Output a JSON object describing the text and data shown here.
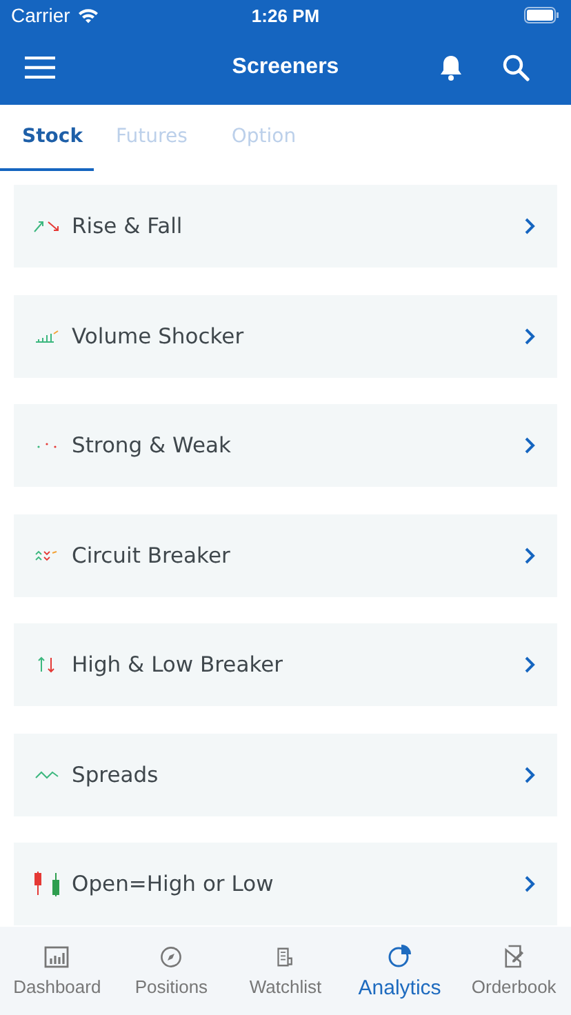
{
  "status_bar": {
    "carrier": "Carrier",
    "time": "1:26 PM"
  },
  "header": {
    "title": "Screeners"
  },
  "tabs": [
    {
      "label": "Stock",
      "selected": true
    },
    {
      "label": "Futures",
      "selected": false
    },
    {
      "label": "Option",
      "selected": false
    }
  ],
  "screeners": [
    {
      "label": "Rise & Fall",
      "kind": "risefall"
    },
    {
      "label": "Volume Shocker",
      "kind": "volume"
    },
    {
      "label": "Strong & Weak",
      "kind": "dots"
    },
    {
      "label": "Circuit Breaker",
      "kind": "circuit"
    },
    {
      "label": "High & Low Breaker",
      "kind": "updown"
    },
    {
      "label": "Spreads",
      "kind": "wave"
    },
    {
      "label": "Open=High or Low",
      "kind": "candles"
    }
  ],
  "bottom_nav": [
    {
      "label": "Dashboard",
      "kind": "dashboard",
      "selected": false
    },
    {
      "label": "Positions",
      "kind": "positions",
      "selected": false
    },
    {
      "label": "Watchlist",
      "kind": "watchlist",
      "selected": false
    },
    {
      "label": "Analytics",
      "kind": "analytics",
      "selected": true
    },
    {
      "label": "Orderbook",
      "kind": "orderbook",
      "selected": false
    }
  ]
}
